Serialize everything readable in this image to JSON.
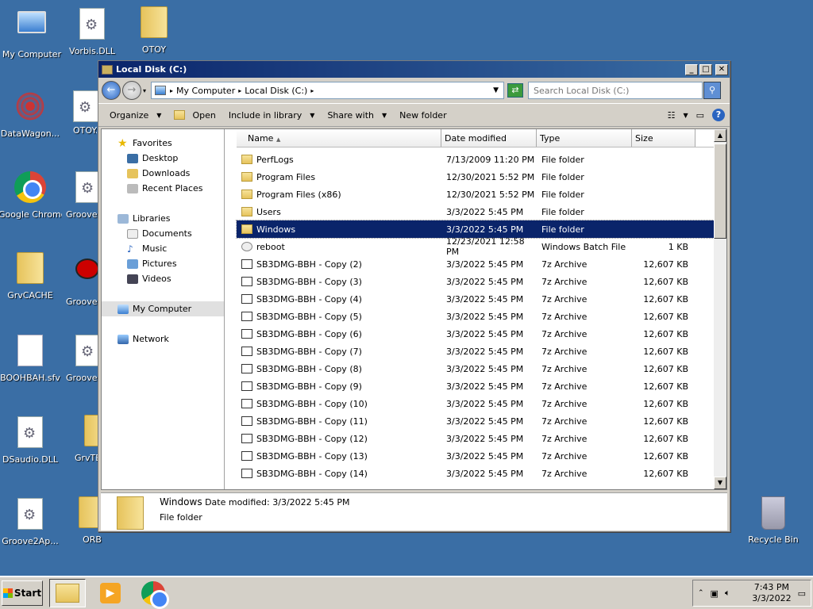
{
  "desktop": {
    "icons": [
      {
        "label": "My Computer",
        "icon": "computer-icon"
      },
      {
        "label": "Vorbis.DLL",
        "icon": "dll-file-icon"
      },
      {
        "label": "OTOY",
        "icon": "folder-icon"
      },
      {
        "label": "DataWagon...",
        "icon": "shortcut-icon"
      },
      {
        "label": "OTOY...",
        "icon": "dll-file-icon"
      },
      {
        "label": "Google Chrome",
        "icon": "chrome-icon"
      },
      {
        "label": "GrooveF",
        "icon": "dll-file-icon"
      },
      {
        "label": "GrvCACHE",
        "icon": "folder-icon"
      },
      {
        "label": "GrooveF",
        "icon": "bug-icon"
      },
      {
        "label": "BOOHBAH.sfv",
        "icon": "file-icon"
      },
      {
        "label": "GrooveM",
        "icon": "dll-file-icon"
      },
      {
        "label": "DSaudio.DLL",
        "icon": "dll-file-icon"
      },
      {
        "label": "GrvTE",
        "icon": "folder-icon"
      },
      {
        "label": "Groove2Ap...",
        "icon": "dll-file-icon"
      },
      {
        "label": "ORB",
        "icon": "folder-icon"
      },
      {
        "label": "Recycle Bin",
        "icon": "recycle-bin-icon"
      }
    ]
  },
  "window": {
    "title": "Local Disk (C:)",
    "address": {
      "crumb1": "My Computer",
      "crumb2": "Local Disk (C:)"
    },
    "search_placeholder": "Search Local Disk (C:)",
    "toolbar": {
      "organize": "Organize",
      "open": "Open",
      "include": "Include in library",
      "share": "Share with",
      "new_folder": "New folder"
    },
    "nav": {
      "favorites": "Favorites",
      "desktop": "Desktop",
      "downloads": "Downloads",
      "recent": "Recent Places",
      "libraries": "Libraries",
      "documents": "Documents",
      "music": "Music",
      "pictures": "Pictures",
      "videos": "Videos",
      "my_computer": "My Computer",
      "network": "Network"
    },
    "columns": {
      "name": "Name",
      "date": "Date modified",
      "type": "Type",
      "size": "Size"
    },
    "files": [
      {
        "name": "PerfLogs",
        "date": "7/13/2009 11:20 PM",
        "type": "File folder",
        "size": "",
        "icon": "folder"
      },
      {
        "name": "Program Files",
        "date": "12/30/2021 5:52 PM",
        "type": "File folder",
        "size": "",
        "icon": "folder"
      },
      {
        "name": "Program Files (x86)",
        "date": "12/30/2021 5:52 PM",
        "type": "File folder",
        "size": "",
        "icon": "folder"
      },
      {
        "name": "Users",
        "date": "3/3/2022 5:45 PM",
        "type": "File folder",
        "size": "",
        "icon": "folder"
      },
      {
        "name": "Windows",
        "date": "3/3/2022 5:45 PM",
        "type": "File folder",
        "size": "",
        "icon": "folder"
      },
      {
        "name": "reboot",
        "date": "12/23/2021 12:58 PM",
        "type": "Windows Batch File",
        "size": "1 KB",
        "icon": "bat"
      },
      {
        "name": "SB3DMG-BBH - Copy (2)",
        "date": "3/3/2022 5:45 PM",
        "type": "7z Archive",
        "size": "12,607 KB",
        "icon": "arch"
      },
      {
        "name": "SB3DMG-BBH - Copy (3)",
        "date": "3/3/2022 5:45 PM",
        "type": "7z Archive",
        "size": "12,607 KB",
        "icon": "arch"
      },
      {
        "name": "SB3DMG-BBH - Copy (4)",
        "date": "3/3/2022 5:45 PM",
        "type": "7z Archive",
        "size": "12,607 KB",
        "icon": "arch"
      },
      {
        "name": "SB3DMG-BBH - Copy (5)",
        "date": "3/3/2022 5:45 PM",
        "type": "7z Archive",
        "size": "12,607 KB",
        "icon": "arch"
      },
      {
        "name": "SB3DMG-BBH - Copy (6)",
        "date": "3/3/2022 5:45 PM",
        "type": "7z Archive",
        "size": "12,607 KB",
        "icon": "arch"
      },
      {
        "name": "SB3DMG-BBH - Copy (7)",
        "date": "3/3/2022 5:45 PM",
        "type": "7z Archive",
        "size": "12,607 KB",
        "icon": "arch"
      },
      {
        "name": "SB3DMG-BBH - Copy (8)",
        "date": "3/3/2022 5:45 PM",
        "type": "7z Archive",
        "size": "12,607 KB",
        "icon": "arch"
      },
      {
        "name": "SB3DMG-BBH - Copy (9)",
        "date": "3/3/2022 5:45 PM",
        "type": "7z Archive",
        "size": "12,607 KB",
        "icon": "arch"
      },
      {
        "name": "SB3DMG-BBH - Copy (10)",
        "date": "3/3/2022 5:45 PM",
        "type": "7z Archive",
        "size": "12,607 KB",
        "icon": "arch"
      },
      {
        "name": "SB3DMG-BBH - Copy (11)",
        "date": "3/3/2022 5:45 PM",
        "type": "7z Archive",
        "size": "12,607 KB",
        "icon": "arch"
      },
      {
        "name": "SB3DMG-BBH - Copy (12)",
        "date": "3/3/2022 5:45 PM",
        "type": "7z Archive",
        "size": "12,607 KB",
        "icon": "arch"
      },
      {
        "name": "SB3DMG-BBH - Copy (13)",
        "date": "3/3/2022 5:45 PM",
        "type": "7z Archive",
        "size": "12,607 KB",
        "icon": "arch"
      },
      {
        "name": "SB3DMG-BBH - Copy (14)",
        "date": "3/3/2022 5:45 PM",
        "type": "7z Archive",
        "size": "12,607 KB",
        "icon": "arch"
      }
    ],
    "selected_index": 4,
    "details": {
      "name": "Windows",
      "date_label": "Date modified:",
      "date": "3/3/2022 5:45 PM",
      "type": "File folder"
    }
  },
  "taskbar": {
    "start": "Start",
    "time": "7:43 PM",
    "date": "3/3/2022"
  },
  "colors": {
    "desktop": "#3a6ea5",
    "selection": "#0a246a"
  }
}
